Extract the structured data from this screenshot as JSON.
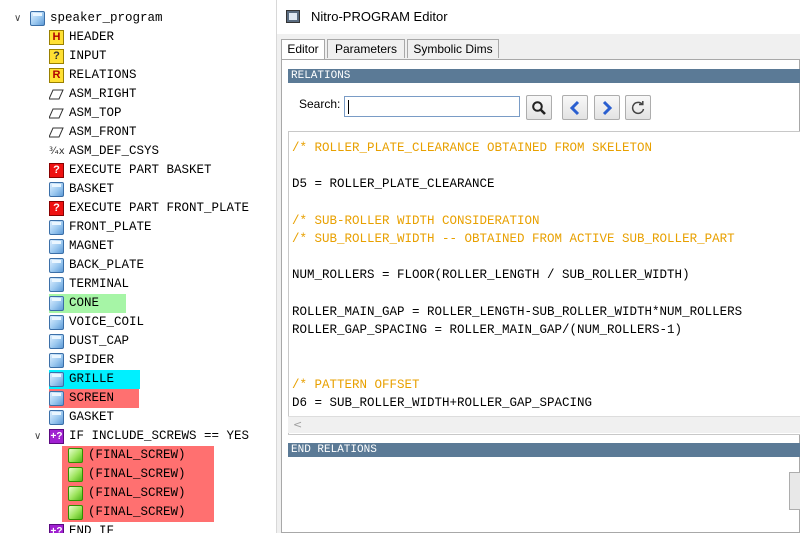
{
  "tree": {
    "root_label": "speaker_program",
    "items": [
      {
        "label": "HEADER",
        "icon": "header-icon"
      },
      {
        "label": "INPUT",
        "icon": "input-icon"
      },
      {
        "label": "RELATIONS",
        "icon": "relations-icon"
      },
      {
        "label": "ASM_RIGHT",
        "icon": "datum-plane-icon"
      },
      {
        "label": "ASM_TOP",
        "icon": "datum-plane-icon"
      },
      {
        "label": "ASM_FRONT",
        "icon": "datum-plane-icon"
      },
      {
        "label": "ASM_DEF_CSYS",
        "icon": "coordinate-system-icon"
      },
      {
        "label": "EXECUTE PART BASKET",
        "icon": "execute-icon"
      },
      {
        "label": "BASKET",
        "icon": "part-icon"
      },
      {
        "label": "EXECUTE PART FRONT_PLATE",
        "icon": "execute-icon"
      },
      {
        "label": "FRONT_PLATE",
        "icon": "part-icon"
      },
      {
        "label": "MAGNET",
        "icon": "part-icon"
      },
      {
        "label": "BACK_PLATE",
        "icon": "part-icon"
      },
      {
        "label": "TERMINAL",
        "icon": "part-icon"
      },
      {
        "label": "CONE",
        "icon": "part-icon",
        "highlight": "#a6f5a6"
      },
      {
        "label": "VOICE_COIL",
        "icon": "part-icon"
      },
      {
        "label": "DUST_CAP",
        "icon": "part-icon"
      },
      {
        "label": "SPIDER",
        "icon": "part-icon"
      },
      {
        "label": "GRILLE",
        "icon": "part-icon",
        "highlight": "#00f0ff"
      },
      {
        "label": "SCREEN",
        "icon": "part-icon",
        "highlight": "#ff7070"
      },
      {
        "label": "GASKET",
        "icon": "part-icon"
      }
    ],
    "if_block": {
      "label": "IF INCLUDE_SCREWS == YES",
      "icon": "if-icon",
      "children": [
        {
          "label": "(FINAL_SCREW)",
          "icon": "green-part-icon"
        },
        {
          "label": "(FINAL_SCREW)",
          "icon": "green-part-icon"
        },
        {
          "label": "(FINAL_SCREW)",
          "icon": "green-part-icon"
        },
        {
          "label": "(FINAL_SCREW)",
          "icon": "green-part-icon"
        }
      ],
      "highlight": "#ff7070"
    },
    "end_if_label": "END_IF"
  },
  "editor": {
    "title": "Nitro-PROGRAM Editor",
    "tabs": [
      {
        "label": "Editor",
        "active": true
      },
      {
        "label": "Parameters",
        "active": false
      },
      {
        "label": "Symbolic Dims",
        "active": false
      }
    ],
    "section_header": "RELATIONS",
    "section_footer": "END RELATIONS",
    "search": {
      "label": "Search:",
      "value": "",
      "placeholder": ""
    },
    "buttons": [
      "search-icon",
      "previous-icon",
      "next-icon",
      "refresh-icon"
    ],
    "code_lines": [
      {
        "text": "/* ROLLER_PLATE_CLEARANCE OBTAINED FROM SKELETON",
        "comment": true
      },
      {
        "text": "",
        "comment": false
      },
      {
        "text": "D5 = ROLLER_PLATE_CLEARANCE",
        "comment": false
      },
      {
        "text": "",
        "comment": false
      },
      {
        "text": "/* SUB-ROLLER WIDTH CONSIDERATION",
        "comment": true
      },
      {
        "text": "/* SUB_ROLLER_WIDTH -- OBTAINED FROM ACTIVE SUB_ROLLER_PART",
        "comment": true
      },
      {
        "text": "",
        "comment": false
      },
      {
        "text": "NUM_ROLLERS = FLOOR(ROLLER_LENGTH / SUB_ROLLER_WIDTH)",
        "comment": false
      },
      {
        "text": "",
        "comment": false
      },
      {
        "text": "ROLLER_MAIN_GAP = ROLLER_LENGTH-SUB_ROLLER_WIDTH*NUM_ROLLERS",
        "comment": false
      },
      {
        "text": "ROLLER_GAP_SPACING = ROLLER_MAIN_GAP/(NUM_ROLLERS-1)",
        "comment": false
      },
      {
        "text": "",
        "comment": false
      },
      {
        "text": "",
        "comment": false
      },
      {
        "text": "/* PATTERN OFFSET",
        "comment": true
      },
      {
        "text": "D6 = SUB_ROLLER_WIDTH+ROLLER_GAP_SPACING",
        "comment": false
      }
    ],
    "comment_color": "#e8a000"
  }
}
